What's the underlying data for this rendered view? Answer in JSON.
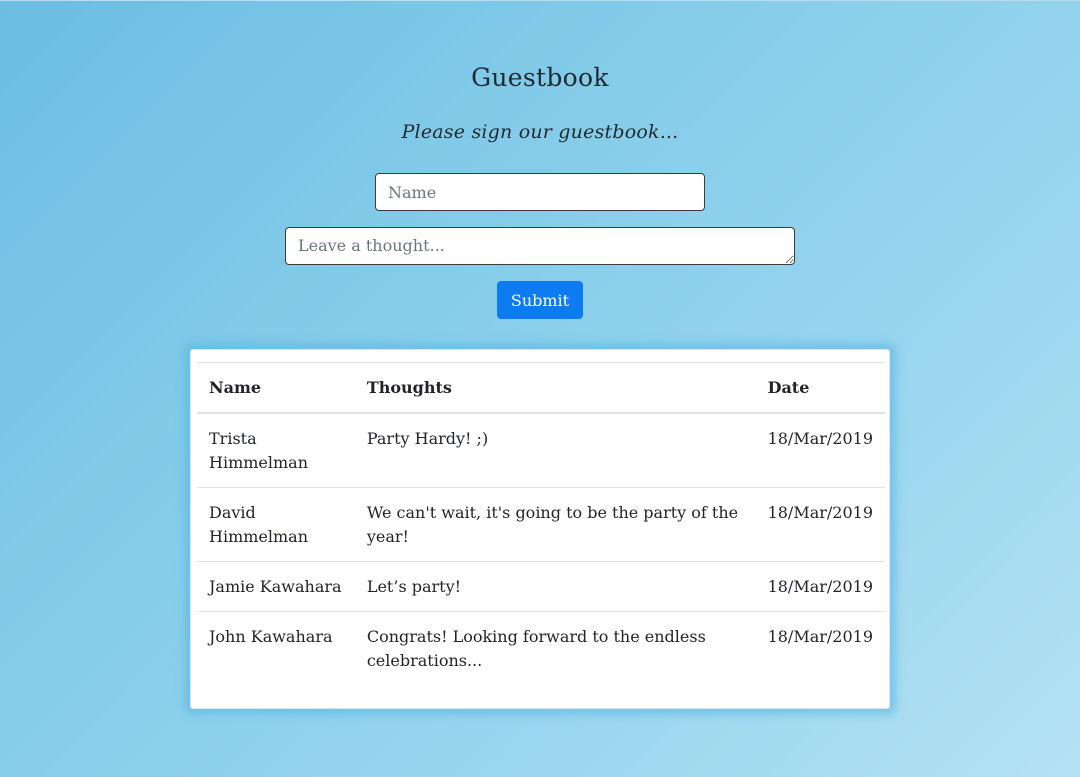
{
  "page": {
    "title": "Guestbook",
    "subtitle": "Please sign our guestbook..."
  },
  "form": {
    "name_placeholder": "Name",
    "thought_placeholder": "Leave a thought...",
    "submit_label": "Submit"
  },
  "table": {
    "headers": {
      "name": "Name",
      "thoughts": "Thoughts",
      "date": "Date"
    },
    "rows": [
      {
        "name": "Trista Himmelman",
        "thought": "Party Hardy! ;)",
        "date": "18/Mar/2019"
      },
      {
        "name": "David Himmelman",
        "thought": "We can't wait, it's going to be the party of the year!",
        "date": "18/Mar/2019"
      },
      {
        "name": "Jamie Kawahara",
        "thought": "Let’s party!",
        "date": "18/Mar/2019"
      },
      {
        "name": "John Kawahara",
        "thought": "Congrats! Looking forward to the endless celebrations...",
        "date": "18/Mar/2019"
      }
    ]
  },
  "colors": {
    "background_start": "#6cbde3",
    "background_end": "#b4e2f4",
    "button": "#0d7cf2",
    "card": "#ffffff"
  }
}
